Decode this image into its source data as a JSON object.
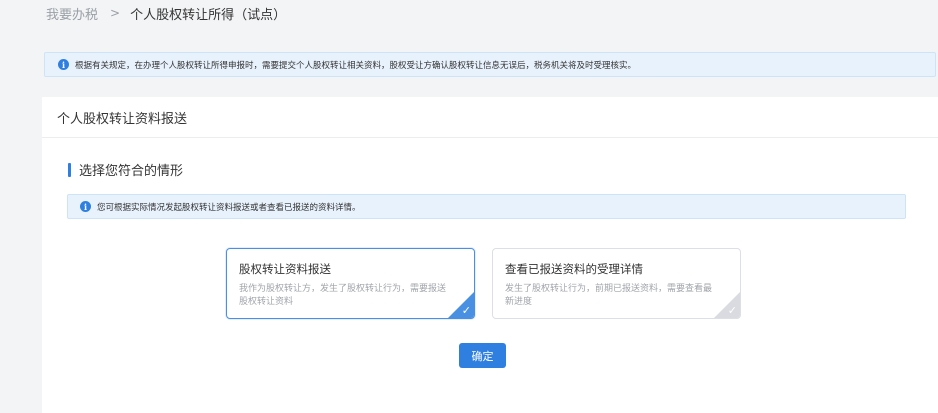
{
  "breadcrumb": {
    "root": "我要办税",
    "separator": ">",
    "current": "个人股权转让所得（试点）"
  },
  "notice_top": {
    "icon": "info-icon",
    "text": "根据有关规定，在办理个人股权转让所得申报时，需要提交个人股权转让相关资料，股权受让方确认股权转让信息无误后，税务机关将及时受理核实。"
  },
  "card": {
    "title": "个人股权转让资料报送",
    "section_title": "选择您符合的情形",
    "notice": {
      "icon": "info-icon",
      "text": "您可根据实际情况发起股权转让资料报送或者查看已报送的资料详情。"
    },
    "options": [
      {
        "title": "股权转让资料报送",
        "desc": "我作为股权转让方，发生了股权转让行为，需要报送股权转让资料",
        "selected": true
      },
      {
        "title": "查看已报送资料的受理详情",
        "desc": "发生了股权转让行为，前期已报送资料，需要查看最新进度",
        "selected": false
      }
    ],
    "confirm_label": "确定"
  },
  "colors": {
    "accent": "#2f7fe0",
    "notice_bg": "#e8f2fc",
    "selected_border": "#4a90e2",
    "unselected_corner": "#d9dbe0"
  }
}
